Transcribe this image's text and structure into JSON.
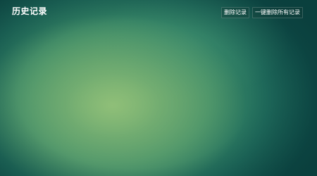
{
  "header": {
    "title": "历史记录",
    "delete_label": "删除记录",
    "delete_all_label": "一键删除所有记录"
  }
}
